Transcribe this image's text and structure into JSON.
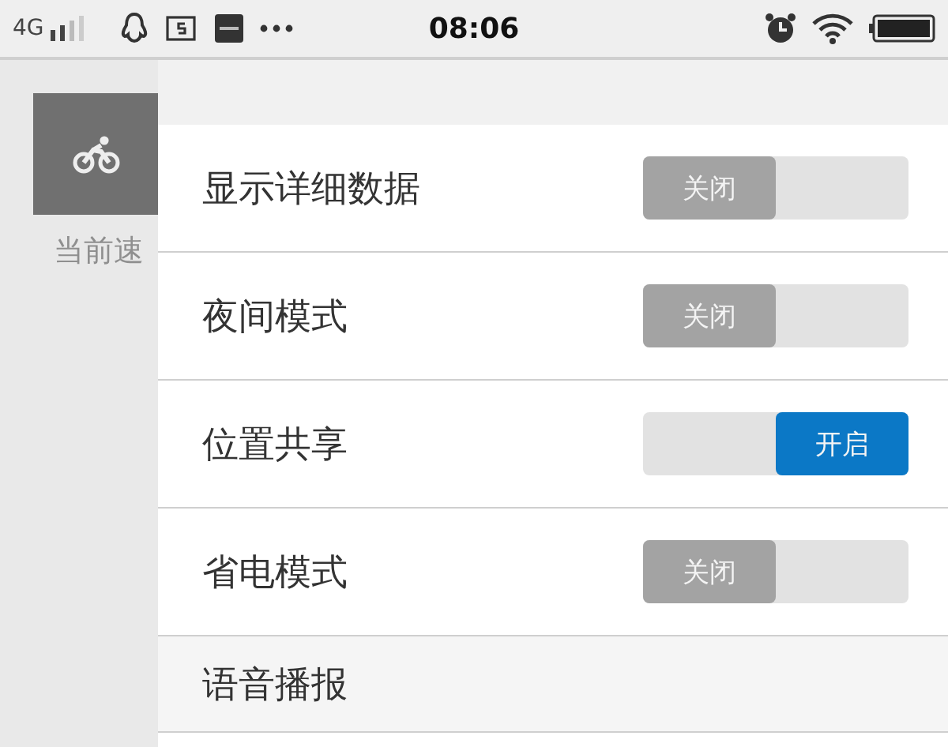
{
  "status_bar": {
    "network": "4G",
    "time": "08:06"
  },
  "sidebar": {
    "label": "当前速"
  },
  "settings": [
    {
      "kind": "toggle",
      "label": "显示详细数据",
      "on": false,
      "state_text": "关闭"
    },
    {
      "kind": "toggle",
      "label": "夜间模式",
      "on": false,
      "state_text": "关闭"
    },
    {
      "kind": "toggle",
      "label": "位置共享",
      "on": true,
      "state_text": "开启"
    },
    {
      "kind": "toggle",
      "label": "省电模式",
      "on": false,
      "state_text": "关闭"
    },
    {
      "kind": "section",
      "label": "语音播报"
    }
  ]
}
